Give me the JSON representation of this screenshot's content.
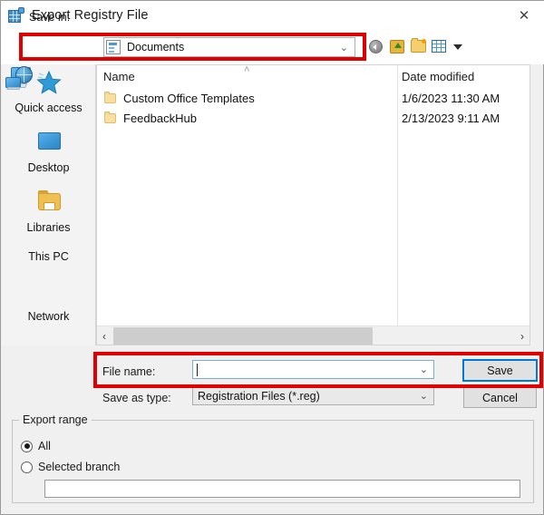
{
  "window": {
    "title": "Export Registry File",
    "icon": "registry-file-icon",
    "close_label": "✕"
  },
  "savein": {
    "label": "Save in:",
    "value": "Documents",
    "arrow": "⌄",
    "toolbar": [
      {
        "name": "back-icon",
        "tooltip": "Back"
      },
      {
        "name": "up-one-level-icon",
        "tooltip": "Up one level"
      },
      {
        "name": "new-folder-icon",
        "tooltip": "Create New Folder"
      },
      {
        "name": "views-icon",
        "tooltip": "Views"
      }
    ]
  },
  "places": [
    {
      "label": "Quick access",
      "icon": "quick-access-star-icon"
    },
    {
      "label": "Desktop",
      "icon": "desktop-monitor-icon"
    },
    {
      "label": "Libraries",
      "icon": "libraries-folder-icon"
    },
    {
      "label": "This PC",
      "icon": "this-pc-icon"
    },
    {
      "label": "Network",
      "icon": "network-globe-icon"
    }
  ],
  "filelist": {
    "columns": [
      "Name",
      "Date modified"
    ],
    "sort_indicator": "˄",
    "rows": [
      {
        "name": "Custom Office Templates",
        "date": "1/6/2023 11:30 AM"
      },
      {
        "name": "FeedbackHub",
        "date": "2/13/2023 9:11 AM"
      }
    ],
    "scroll_left": "‹",
    "scroll_right": "›"
  },
  "form": {
    "filename_label": "File name:",
    "filename_value": "",
    "filename_arrow": "⌄",
    "savetype_label": "Save as type:",
    "savetype_value": "Registration Files (*.reg)",
    "savetype_arrow": "⌄",
    "save_button": "Save",
    "cancel_button": "Cancel"
  },
  "export_range": {
    "title": "Export range",
    "options": [
      {
        "label": "All",
        "selected": true
      },
      {
        "label": "Selected branch",
        "selected": false
      }
    ],
    "branch_value": ""
  },
  "colors": {
    "highlight": "#e00000",
    "focus": "#0078d7",
    "dialog_bg": "#f0f0f0",
    "panel_bg": "#ffffff"
  }
}
